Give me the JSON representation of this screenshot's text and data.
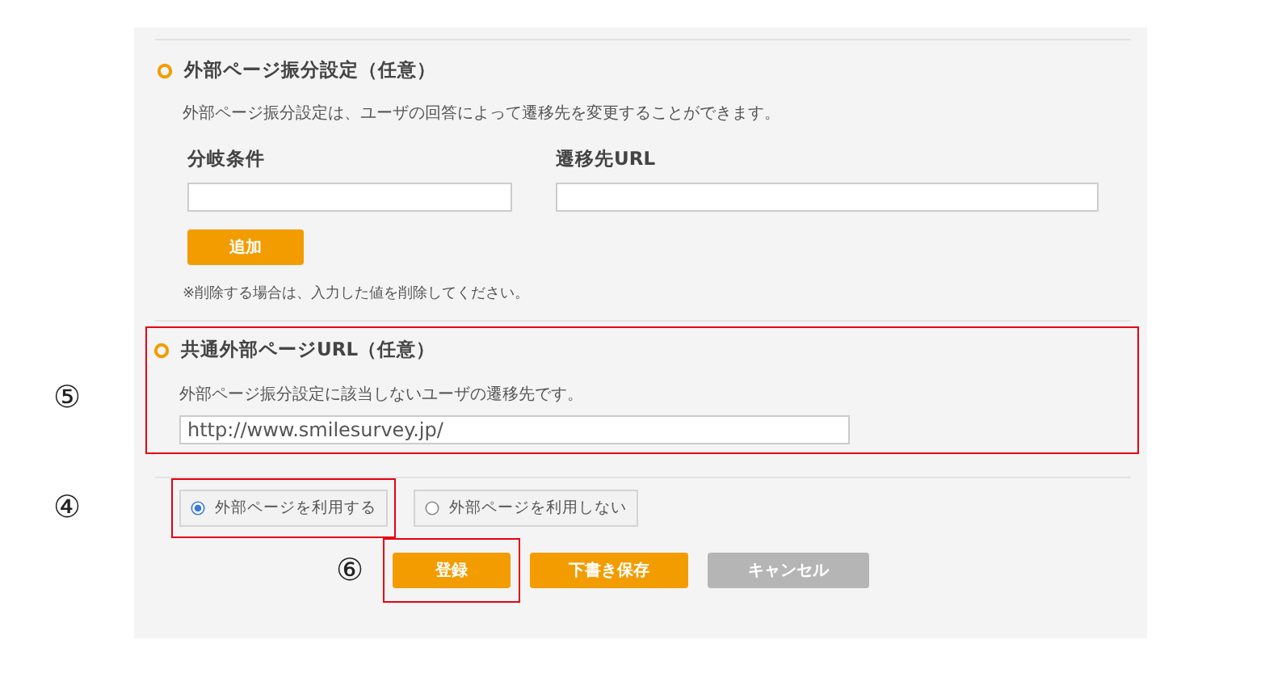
{
  "branch_section": {
    "title": "外部ページ振分設定（任意）",
    "description": "外部ページ振分設定は、ユーザの回答によって遷移先を変更することができます。",
    "fields": [
      {
        "label": "分岐条件"
      },
      {
        "label": "遷移先URL"
      }
    ],
    "add_button": "追加",
    "note": "※削除する場合は、入力した値を削除してください。"
  },
  "common_section": {
    "marker": "⑤",
    "title": "共通外部ページURL（任意）",
    "description": "外部ページ振分設定に該当しないユーザの遷移先です。",
    "highlighted": true,
    "url": "http://www.smilesurvey.jp/"
  },
  "usage": {
    "marker": "④",
    "options": [
      {
        "label": "外部ページを利用する",
        "selected": true,
        "highlighted": true
      },
      {
        "label": "外部ページを利用しない",
        "selected": false,
        "highlighted": false
      }
    ]
  },
  "buttons": [
    {
      "label": "登録",
      "kind": "primary",
      "highlighted": true,
      "marker": "⑥"
    },
    {
      "label": "下書き保存",
      "kind": "primary",
      "highlighted": false
    },
    {
      "label": "キャンセル",
      "kind": "muted",
      "highlighted": false
    }
  ]
}
